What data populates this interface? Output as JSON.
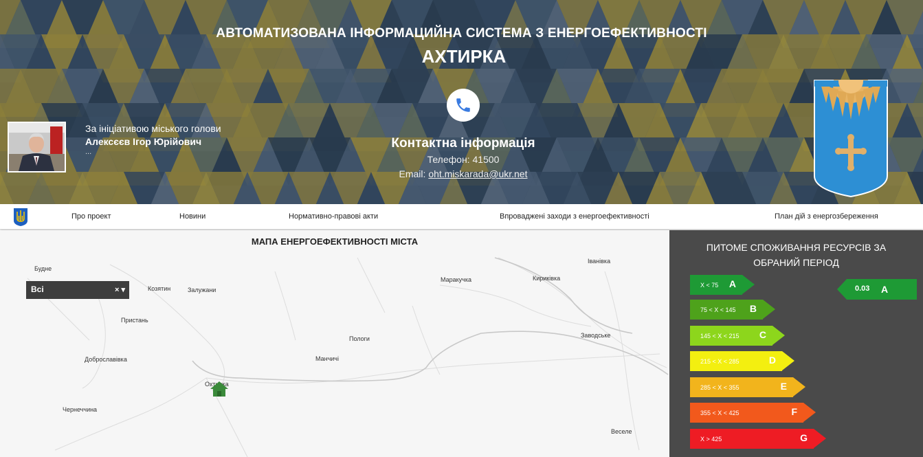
{
  "header": {
    "title_line1": "АВТОМАТИЗОВАНА ІНФОРМАЦИЙНА СИСТЕМА З ЕНЕРГОЕФЕКТИВНОСТІ",
    "title_line2": "АХТИРКА",
    "mayor": {
      "line1": "За ініціативою міського голови",
      "name": "Алексєєв Ігор Юрійович",
      "more": "..."
    },
    "contact": {
      "title": "Контактна інформація",
      "phone": "Телефон: 41500",
      "email_label": "Email:",
      "email": "oht.miskarada@ukr.net"
    }
  },
  "nav": {
    "items": [
      "Про проект",
      "Новини",
      "Нормативно-правові акти",
      "Впроваджені заходи з енергоефективності",
      "План дій з енергозбереження"
    ]
  },
  "map": {
    "title": "МАПА ЕНЕРГОЕФЕКТИВНОСТІ МІСТА",
    "select_value": "Всі",
    "select_clear": "×",
    "places": [
      "Будне",
      "Козятин",
      "Залужани",
      "Пристань",
      "Доброславівка",
      "Чернеччина",
      "Охтирка",
      "Манчичі",
      "Пологи",
      "Маракучка",
      "Кириківка",
      "Іванівка",
      "Заводське",
      "Веселе"
    ]
  },
  "panel": {
    "title_line1": "ПИТОМЕ СПОЖИВАННЯ РЕСУРСІВ ЗА",
    "title_line2": "ОБРАНИЙ ПЕРІОД",
    "classes": [
      {
        "range": "X < 75",
        "letter": "A",
        "color": "#1e9a35"
      },
      {
        "range": "75 < X < 145",
        "letter": "B",
        "color": "#4ea21b"
      },
      {
        "range": "145 < X < 215",
        "letter": "C",
        "color": "#8dd61c"
      },
      {
        "range": "215 < X < 285",
        "letter": "D",
        "color": "#f3ef10"
      },
      {
        "range": "285 < X < 355",
        "letter": "E",
        "color": "#f2b41c"
      },
      {
        "range": "355 < X < 425",
        "letter": "F",
        "color": "#f2591c"
      },
      {
        "range": "X > 425",
        "letter": "G",
        "color": "#ee1c24"
      }
    ],
    "result": {
      "value": "0.03",
      "letter": "A"
    }
  }
}
